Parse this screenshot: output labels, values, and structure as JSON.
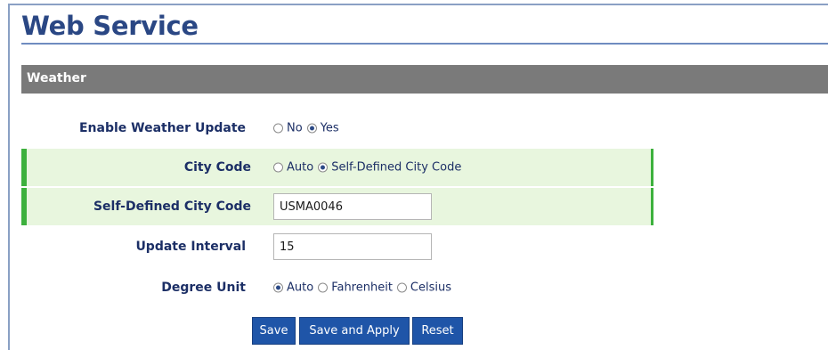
{
  "page": {
    "title": "Web Service"
  },
  "section": {
    "title": "Weather"
  },
  "weather_update": {
    "label": "Enable Weather Update",
    "options": [
      {
        "label": "No",
        "selected": false
      },
      {
        "label": "Yes",
        "selected": true
      }
    ]
  },
  "city_code": {
    "label": "City Code",
    "options": [
      {
        "label": "Auto",
        "selected": false
      },
      {
        "label": "Self-Defined City Code",
        "selected": true
      }
    ]
  },
  "self_defined_city_code": {
    "label": "Self-Defined City Code",
    "value": "USMA0046"
  },
  "update_interval": {
    "label": "Update Interval",
    "value": "15"
  },
  "degree_unit": {
    "label": "Degree Unit",
    "options": [
      {
        "label": "Auto",
        "selected": true
      },
      {
        "label": "Fahrenheit",
        "selected": false
      },
      {
        "label": "Celsius",
        "selected": false
      }
    ]
  },
  "buttons": {
    "save": "Save",
    "save_apply": "Save and Apply",
    "reset": "Reset"
  },
  "colors": {
    "brand": "#2a4784",
    "section_bar": "#7a7a7a",
    "highlight_row": "#e8f6de",
    "highlight_border": "#3db13d",
    "button": "#1f55a8"
  }
}
